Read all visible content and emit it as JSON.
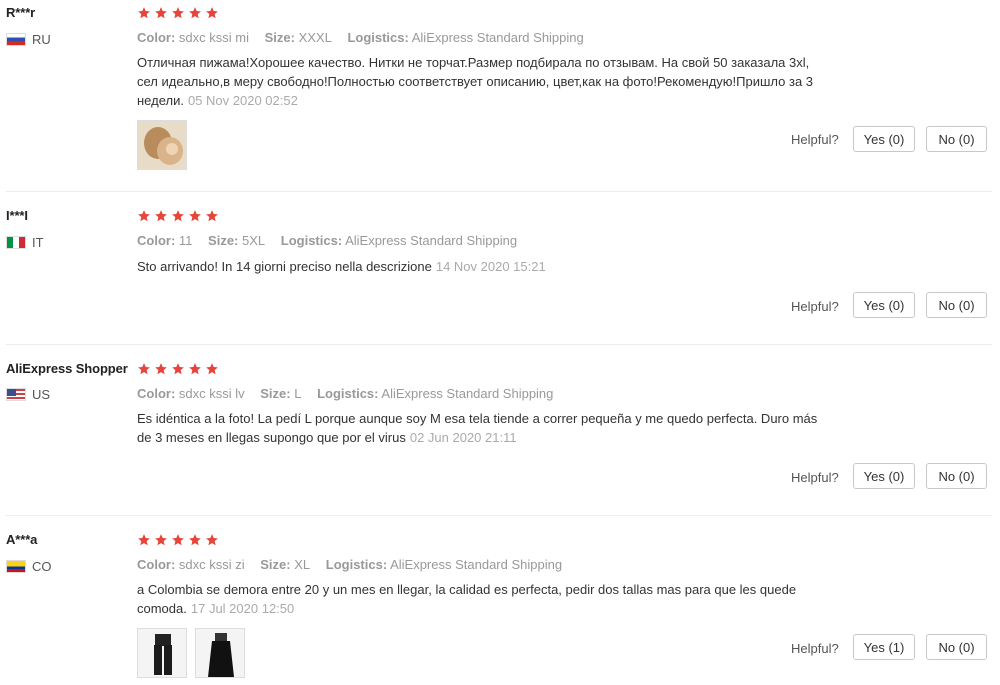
{
  "labels": {
    "color": "Color:",
    "size": "Size:",
    "logistics": "Logistics:",
    "helpful": "Helpful?"
  },
  "star_color": "#e5453a",
  "reviews": [
    {
      "user": "R***r",
      "country": "RU",
      "rating": 5,
      "color": "sdxc kssi mi",
      "size": "XXXL",
      "logistics": "AliExpress Standard Shipping",
      "text_lines": [
        "Отличная пижама!Хорошее качество. Нитки не торчат.Размер подбирала по отзывам. На свой 50 заказала 3xl,",
        "сел идеально,в меру свободно!Полностью соответствует описанию, цвет,как на фото!Рекомендую!Пришло за 3",
        "недели."
      ],
      "date": "05 Nov 2020 02:52",
      "yes": "Yes (0)",
      "no": "No (0)"
    },
    {
      "user": "I***I",
      "country": "IT",
      "rating": 5,
      "color": "11",
      "size": "5XL",
      "logistics": "AliExpress Standard Shipping",
      "text_lines": [
        "Sto arrivando! In 14 giorni preciso nella descrizione"
      ],
      "date": "14 Nov 2020 15:21",
      "yes": "Yes (0)",
      "no": "No (0)"
    },
    {
      "user": "AliExpress Shopper",
      "country": "US",
      "rating": 5,
      "color": "sdxc kssi lv",
      "size": "L",
      "logistics": "AliExpress Standard Shipping",
      "text_lines": [
        "Es idéntica a la foto! La pedí L porque aunque soy M esa tela tiende a correr pequeña y me quedo perfecta. Duro más",
        "de 3 meses en llegas supongo que por el virus"
      ],
      "date": "02 Jun 2020 21:11",
      "yes": "Yes (0)",
      "no": "No (0)"
    },
    {
      "user": "A***a",
      "country": "CO",
      "rating": 5,
      "color": "sdxc kssi zi",
      "size": "XL",
      "logistics": "AliExpress Standard Shipping",
      "text_lines": [
        "a Colombia se demora entre 20 y un mes en llegar, la calidad es perfecta, pedir dos tallas mas para que les quede",
        "comoda."
      ],
      "date": "17 Jul 2020 12:50",
      "yes": "Yes (1)",
      "no": "No (0)"
    }
  ]
}
